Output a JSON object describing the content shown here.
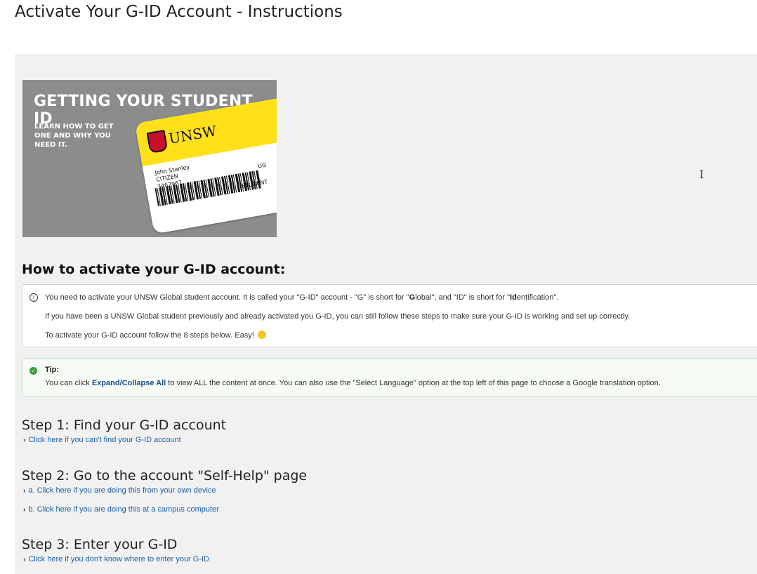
{
  "page": {
    "title": "Activate Your G-ID Account - Instructions"
  },
  "banner": {
    "heading": "GETTING YOUR STUDENT ID",
    "subheading": "LEARN HOW TO GET ONE AND WHY YOU NEED IT.",
    "card": {
      "logo_text": "UNSW",
      "holder": "John Stanley\nCITIZEN\n3462967",
      "level": "UG",
      "role": "STUDENT"
    }
  },
  "section": {
    "heading": "How to activate your G-ID account:"
  },
  "info": {
    "line1_pre": "You need to activate your UNSW Global student account. It is called your \"G-ID\" account - \"G\" is short for \"",
    "line1_g_bold": "G",
    "line1_mid1": "lobal\", and \"ID\" is short for \"",
    "line1_id_bold": "Id",
    "line1_end": "entification\".",
    "line2": "If you have been a UNSW Global student previously and already activated you G-ID, you can still follow these steps to make sure your G-ID is working and set up correctly.",
    "line3": "To activate your G-ID account follow the 8 steps below. Easy!"
  },
  "tip": {
    "label": "Tip:",
    "text_pre": "You can click ",
    "link": "Expand/Collapse All",
    "text_post": " to view ALL the content at once. You can also use the \"Select Language\" option at the top left of this page to choose a Google translation option."
  },
  "steps": [
    {
      "heading": "Step 1: Find your G-ID account",
      "links": [
        "Click here if you can't find your G-ID account"
      ]
    },
    {
      "heading": "Step 2: Go to the account \"Self-Help\" page",
      "links": [
        "a. Click here if you are doing this from your own device",
        "b. Click here if you are doing this at a campus computer"
      ]
    },
    {
      "heading": "Step 3: Enter your G-ID",
      "links": [
        "Click here if you don't know where to enter your G-ID"
      ]
    }
  ],
  "icons": {
    "info": "info-circle-icon",
    "tip": "check-circle-icon",
    "chevron": "chevron-right-icon",
    "cursor": "text-cursor-icon"
  },
  "colors": {
    "link": "#1a5fa8",
    "tip_icon": "#3a9a3a",
    "panel_bg": "#f1f1f1"
  }
}
